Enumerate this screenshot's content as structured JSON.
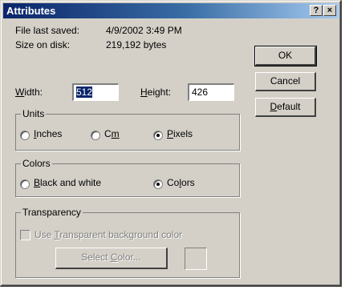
{
  "window": {
    "title": "Attributes",
    "help_label": "?",
    "close_label": "×"
  },
  "info": {
    "last_saved_label": "File last saved:",
    "last_saved_value": "4/9/2002 3:49 PM",
    "size_label": "Size on disk:",
    "size_value": "219,192 bytes"
  },
  "dimensions": {
    "width_label_u": "W",
    "width_label_rest": "idth:",
    "width_value": "512",
    "height_label_u": "H",
    "height_label_rest": "eight:",
    "height_value": "426"
  },
  "units": {
    "legend": "Units",
    "inches_u": "I",
    "inches_rest": "nches",
    "cm_pre": "C",
    "cm_u": "m",
    "pixels_u": "P",
    "pixels_rest": "ixels",
    "selected": "Pixels"
  },
  "colors": {
    "legend": "Colors",
    "bw_u": "B",
    "bw_rest": "lack and white",
    "colors_pre": "Co",
    "colors_u": "l",
    "colors_rest": "ors",
    "selected": "Colors"
  },
  "transparency": {
    "legend": "Transparency",
    "checkbox_pre": "Use ",
    "checkbox_u": "T",
    "checkbox_rest": "ransparent background color",
    "select_pre": "Select ",
    "select_u": "C",
    "select_rest": "olor..."
  },
  "buttons": {
    "ok": "OK",
    "cancel": "Cancel",
    "default_u": "D",
    "default_rest": "efault"
  }
}
